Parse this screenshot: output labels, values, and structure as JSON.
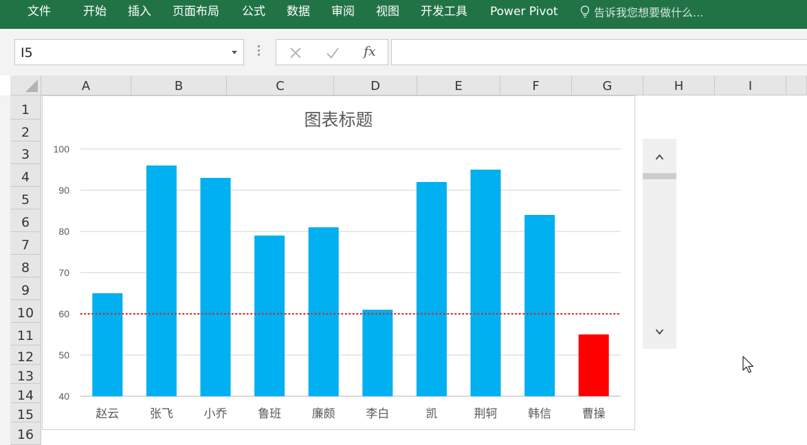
{
  "ribbon": {
    "tabs": [
      "文件",
      "开始",
      "插入",
      "页面布局",
      "公式",
      "数据",
      "审阅",
      "视图",
      "开发工具",
      "Power Pivot"
    ],
    "tell_me": "告诉我您想要做什么...",
    "color": "#217346"
  },
  "formula_bar": {
    "name_box": "I5",
    "fx_label": "fx",
    "formula": ""
  },
  "grid": {
    "columns": [
      "A",
      "B",
      "C",
      "D",
      "E",
      "F",
      "G",
      "H",
      "I"
    ],
    "rows": [
      "1",
      "2",
      "3",
      "4",
      "5",
      "6",
      "7",
      "8",
      "9",
      "10",
      "11",
      "12",
      "13",
      "14",
      "15",
      "16"
    ]
  },
  "chart_data": {
    "type": "bar",
    "title": "图表标题",
    "categories": [
      "赵云",
      "张飞",
      "小乔",
      "鲁班",
      "廉颇",
      "李白",
      "凯",
      "荆轲",
      "韩信",
      "曹操"
    ],
    "values": [
      65,
      96,
      93,
      79,
      81,
      61,
      92,
      95,
      84,
      55
    ],
    "colors": [
      "#00b0f0",
      "#00b0f0",
      "#00b0f0",
      "#00b0f0",
      "#00b0f0",
      "#00b0f0",
      "#00b0f0",
      "#00b0f0",
      "#00b0f0",
      "#ff0000"
    ],
    "yticks": [
      "40",
      "50",
      "60",
      "70",
      "80",
      "90",
      "100"
    ],
    "ylim": [
      40,
      100
    ],
    "reference_line": {
      "value": 60,
      "color": "#e02020",
      "style": "dotted"
    },
    "grid": true,
    "xlabel": "",
    "ylabel": ""
  },
  "scrollbar": {
    "up_icon": "chevron-up-icon",
    "down_icon": "chevron-down-icon",
    "thumb_position": 0
  }
}
